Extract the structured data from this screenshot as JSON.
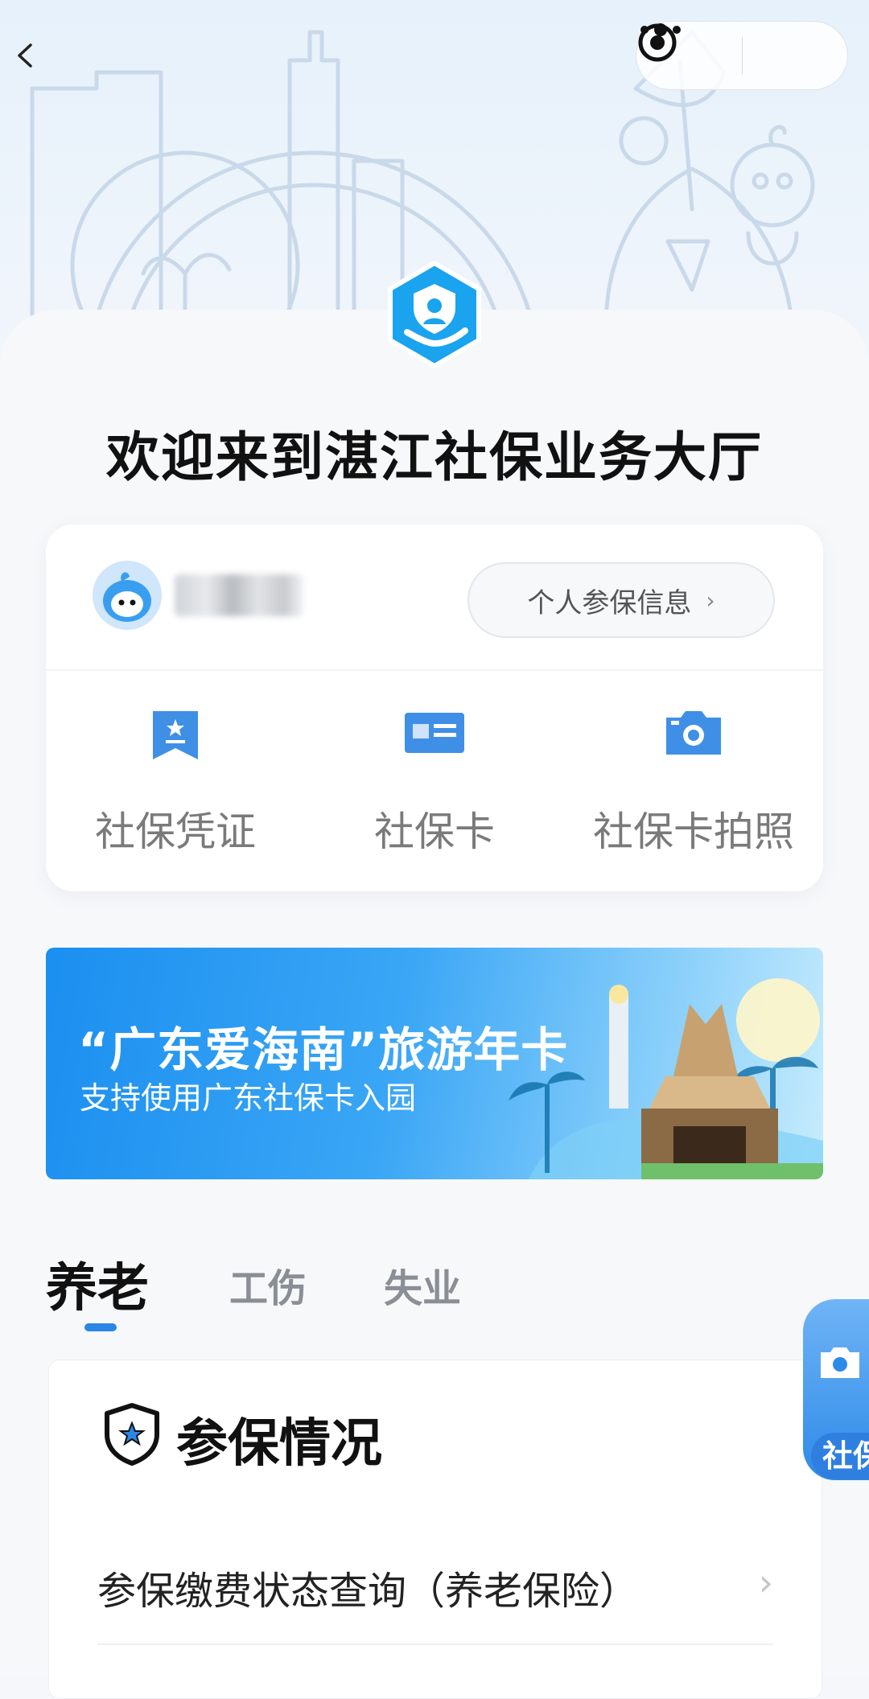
{
  "nav": {
    "back_icon": "chevron-left-icon",
    "more_icon": "more-dots-icon",
    "close_icon": "target-circle-icon"
  },
  "welcome": {
    "title": "欢迎来到湛江社保业务大厅"
  },
  "account": {
    "avatar_icon": "mascot-avatar-icon",
    "personal_info_label": "个人参保信息",
    "personal_info_chevron": "›"
  },
  "services": [
    {
      "label": "社保凭证",
      "icon": "certificate-icon"
    },
    {
      "label": "社保卡",
      "icon": "id-card-icon"
    },
    {
      "label": "社保卡拍照",
      "icon": "camera-icon"
    }
  ],
  "banner": {
    "title": "“广东爱海南”旅游年卡",
    "subtitle": "支持使用广东社保卡入园"
  },
  "tabs": [
    {
      "label": "养老",
      "active": true
    },
    {
      "label": "工伤",
      "active": false
    },
    {
      "label": "失业",
      "active": false
    }
  ],
  "panel": {
    "icon": "shield-star-icon",
    "title": "参保情况",
    "rows": [
      {
        "label": "参保缴费状态查询（养老保险）",
        "chevron": "›"
      }
    ]
  },
  "float_badge": {
    "label": "社保",
    "icon": "camera-icon"
  },
  "colors": {
    "accent": "#2b86e6",
    "logo": "#1aa3ef",
    "banner": "#1b8ff0"
  }
}
